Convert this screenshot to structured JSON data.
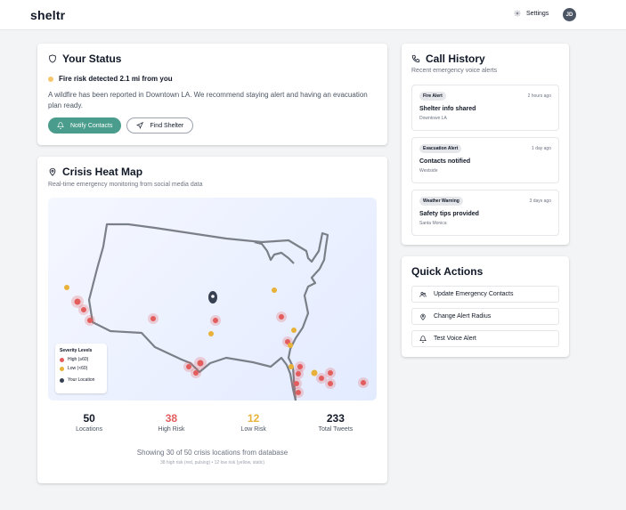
{
  "app": {
    "brand": "sheltr"
  },
  "header": {
    "settings_label": "Settings",
    "avatar_initials": "JD"
  },
  "status": {
    "title": "Your Status",
    "headline": "Fire risk detected 2.1 mi from you",
    "description": "A wildfire has been reported in Downtown LA. We recommend staying alert and having an evacuation plan ready.",
    "notify_label": "Notify Contacts",
    "shelter_label": "Find Shelter"
  },
  "heatmap": {
    "title": "Crisis Heat Map",
    "subtitle": "Real-time emergency monitoring from social media data",
    "legend": {
      "title": "Severity Levels",
      "high": "High (≥60)",
      "low": "Low (<60)",
      "location": "Your Location"
    },
    "stats": [
      {
        "value": "50",
        "label": "Locations",
        "color": "#111827"
      },
      {
        "value": "38",
        "label": "High Risk",
        "color": "#e35d5d"
      },
      {
        "value": "12",
        "label": "Low Risk",
        "color": "#e8b23a"
      },
      {
        "value": "233",
        "label": "Total Tweets",
        "color": "#111827"
      }
    ],
    "footer_main": "Showing 30 of 50 crisis locations from database",
    "footer_sub": "38 high risk (red, pulsing) • 12 low risk (yellow, static)",
    "colors": {
      "high": "#e35d5d",
      "low": "#e8b23a",
      "location": "#374151"
    }
  },
  "history": {
    "title": "Call History",
    "subtitle": "Recent emergency voice alerts",
    "items": [
      {
        "badge": "Fire Alert",
        "time": "2 hours ago",
        "title": "Shelter info shared",
        "location": "Downtown LA"
      },
      {
        "badge": "Evacuation Alert",
        "time": "1 day ago",
        "title": "Contacts notified",
        "location": "Westside"
      },
      {
        "badge": "Weather Warning",
        "time": "3 days ago",
        "title": "Safety tips provided",
        "location": "Santa Monica"
      }
    ]
  },
  "quick_actions": {
    "title": "Quick Actions",
    "items": [
      {
        "label": "Update Emergency Contacts",
        "icon": "users-icon"
      },
      {
        "label": "Change Alert Radius",
        "icon": "map-pin-icon"
      },
      {
        "label": "Test Voice Alert",
        "icon": "bell-icon"
      }
    ]
  },
  "colors": {
    "primary": "#4a9d8c",
    "warning": "#f5c66e"
  }
}
